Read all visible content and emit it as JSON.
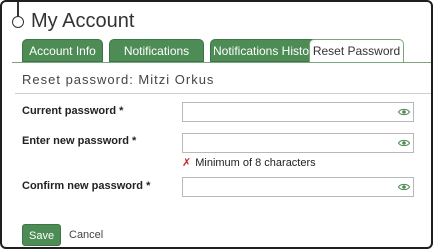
{
  "page": {
    "title": "My Account"
  },
  "tabs": [
    {
      "label": "Account Info"
    },
    {
      "label": "Notifications"
    },
    {
      "label": "Notifications History"
    },
    {
      "label": "Reset Password",
      "active": true
    }
  ],
  "form": {
    "heading": "Reset password: Mitzi Orkus",
    "current_password": {
      "label": "Current password *",
      "value": ""
    },
    "new_password": {
      "label": "Enter new password *",
      "value": ""
    },
    "confirm_password": {
      "label": "Confirm new password *",
      "value": ""
    },
    "validation": {
      "icon": "✗",
      "message": "Minimum of 8 characters"
    },
    "save_label": "Save",
    "cancel_label": "Cancel"
  },
  "colors": {
    "accent": "#4e8c55",
    "error": "#c62828"
  },
  "icons": {
    "reveal": "eye-icon"
  }
}
